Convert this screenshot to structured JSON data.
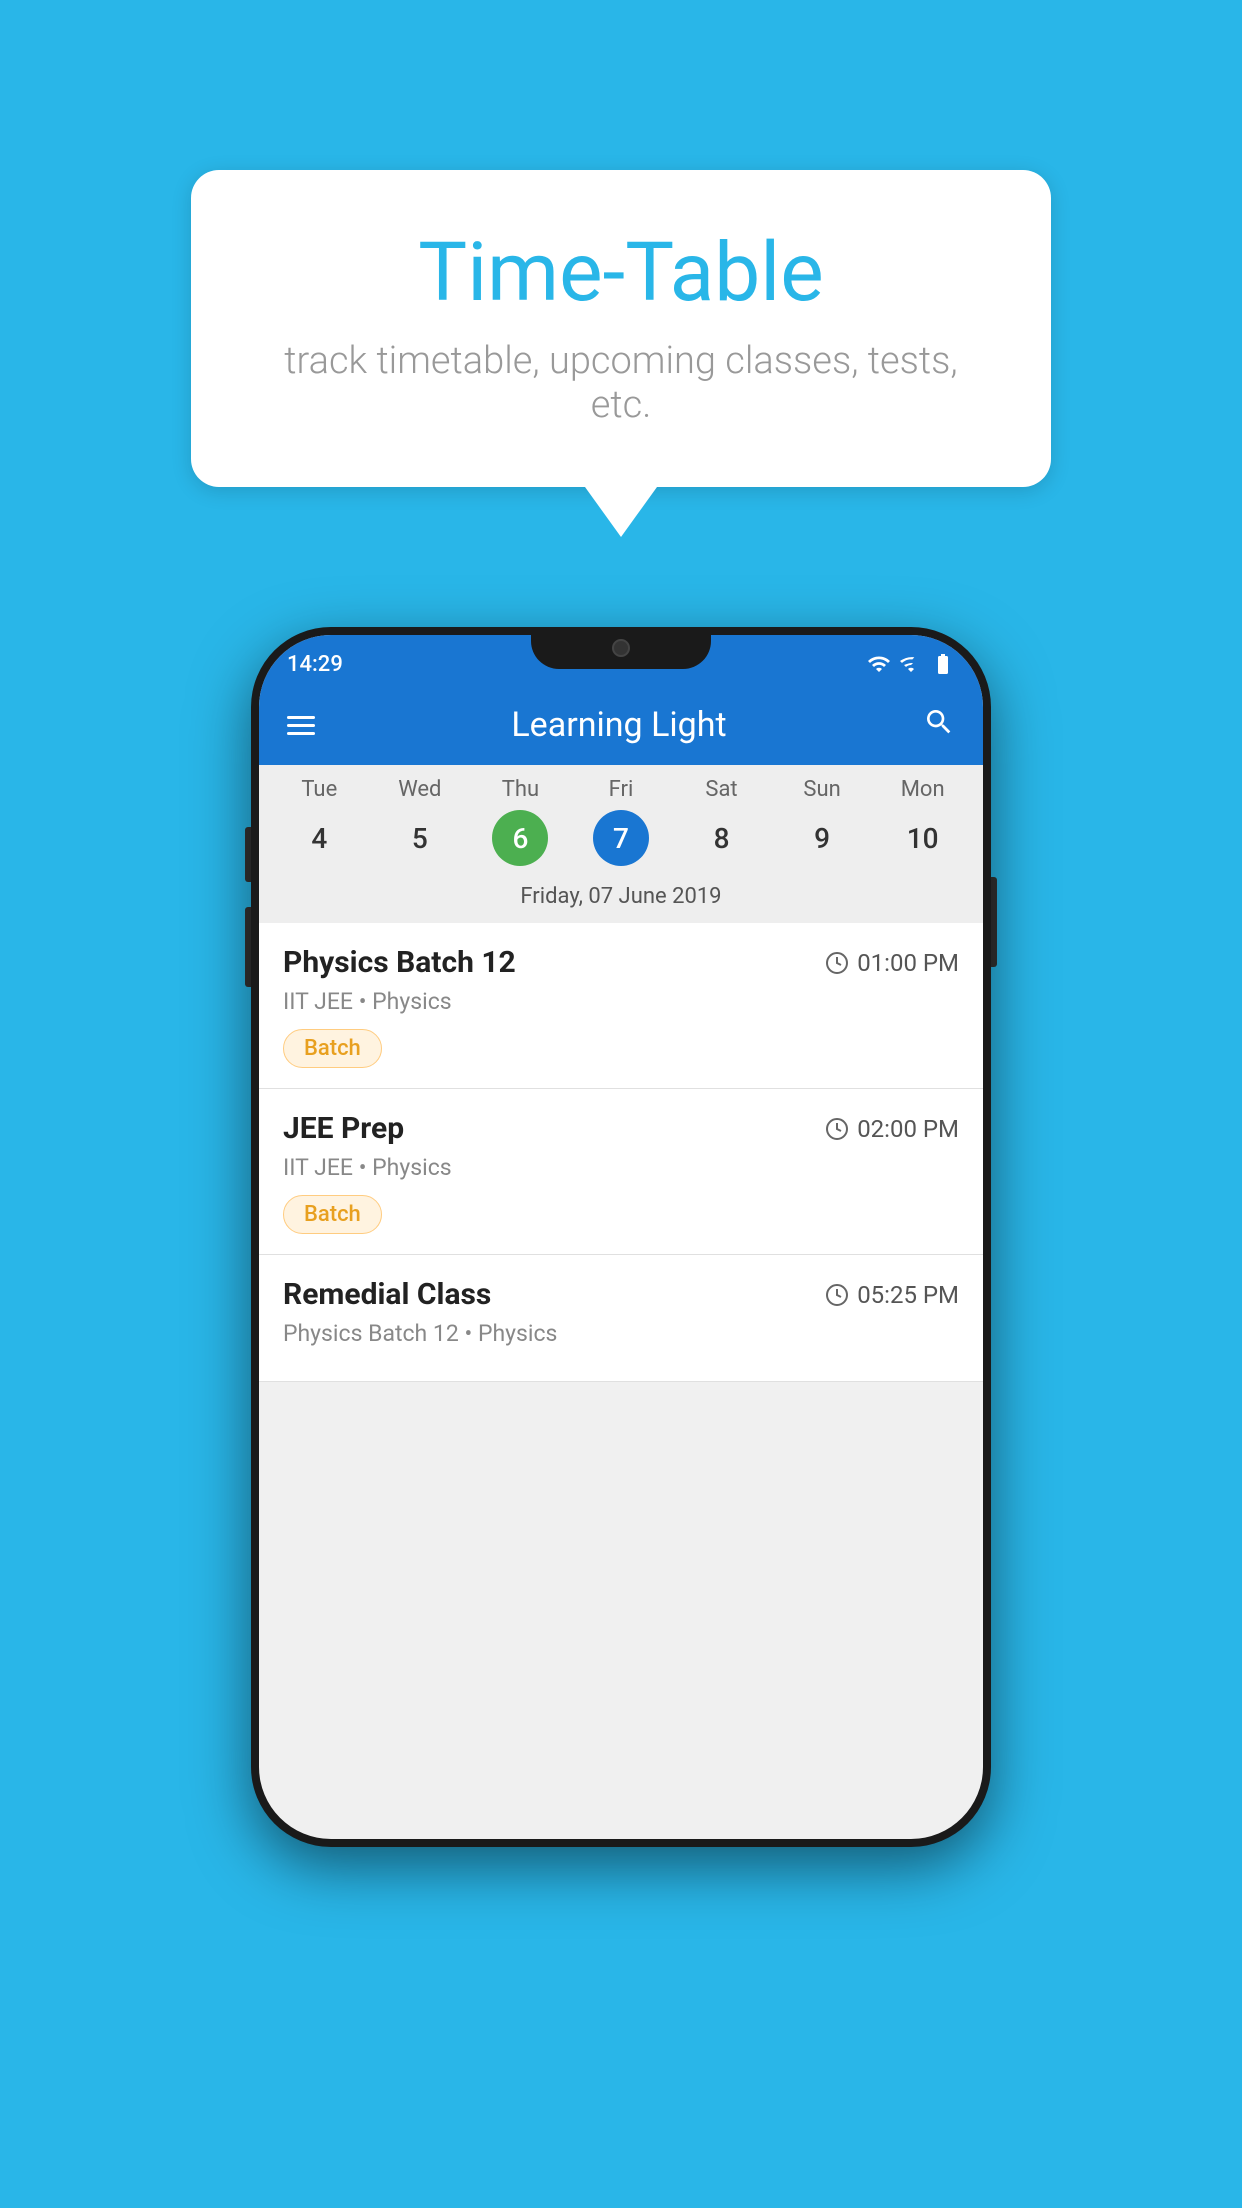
{
  "background_color": "#29b6e8",
  "speech_bubble": {
    "title": "Time-Table",
    "subtitle": "track timetable, upcoming classes, tests, etc."
  },
  "phone": {
    "status_bar": {
      "time": "14:29"
    },
    "app_bar": {
      "title": "Learning Light"
    },
    "calendar": {
      "weekdays": [
        {
          "label": "Tue",
          "num": "4",
          "state": "normal"
        },
        {
          "label": "Wed",
          "num": "5",
          "state": "normal"
        },
        {
          "label": "Thu",
          "num": "6",
          "state": "today"
        },
        {
          "label": "Fri",
          "num": "7",
          "state": "selected"
        },
        {
          "label": "Sat",
          "num": "8",
          "state": "normal"
        },
        {
          "label": "Sun",
          "num": "9",
          "state": "normal"
        },
        {
          "label": "Mon",
          "num": "10",
          "state": "normal"
        }
      ],
      "selected_date_label": "Friday, 07 June 2019"
    },
    "schedule_items": [
      {
        "title": "Physics Batch 12",
        "time": "01:00 PM",
        "subject": "IIT JEE • Physics",
        "badge": "Batch"
      },
      {
        "title": "JEE Prep",
        "time": "02:00 PM",
        "subject": "IIT JEE • Physics",
        "badge": "Batch"
      },
      {
        "title": "Remedial Class",
        "time": "05:25 PM",
        "subject": "Physics Batch 12 • Physics",
        "badge": null
      }
    ]
  }
}
